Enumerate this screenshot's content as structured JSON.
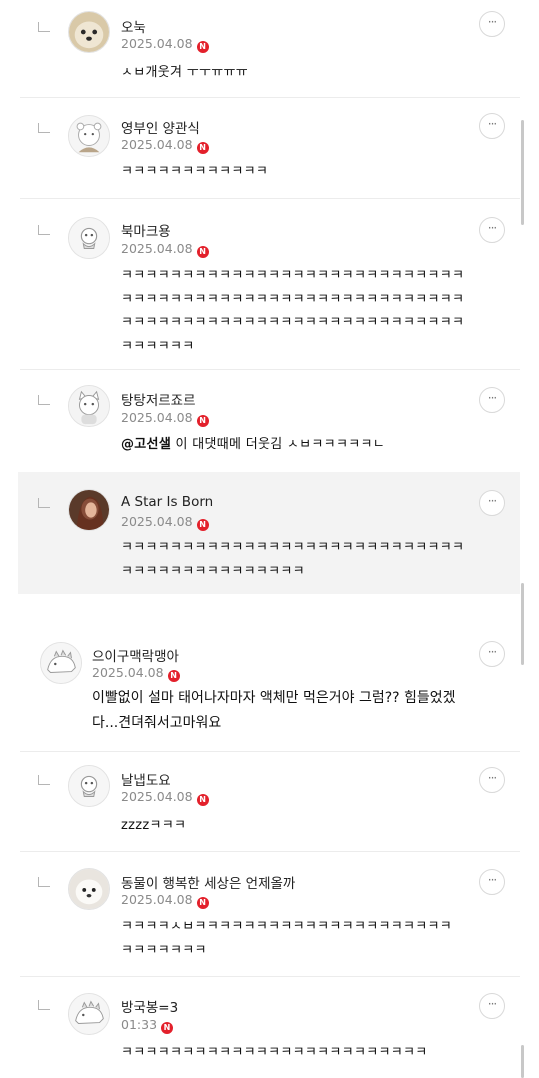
{
  "comments": [
    {
      "nickname": "오눅",
      "date": "2025.04.08",
      "badge": "N",
      "text": "ㅅㅂ개웃겨 ㅜㅜㅠㅠㅠ",
      "avatar": "dog-photo-avatar"
    },
    {
      "nickname": "영부인 양관식",
      "date": "2025.04.08",
      "badge": "N",
      "text": "ㅋㅋㅋㅋㅋㅋㅋㅋㅋㅋㅋㅋ",
      "avatar": "bear-character-avatar"
    },
    {
      "nickname": "북마크용",
      "date": "2025.04.08",
      "badge": "N",
      "text": "ㅋㅋㅋㅋㅋㅋㅋㅋㅋㅋㅋㅋㅋㅋㅋㅋㅋㅋㅋㅋㅋㅋㅋㅋㅋㅋㅋㅋ\nㅋㅋㅋㅋㅋㅋㅋㅋㅋㅋㅋㅋㅋㅋㅋㅋㅋㅋㅋㅋㅋㅋㅋㅋㅋㅋㅋㅋ\nㅋㅋㅋㅋㅋㅋㅋㅋㅋㅋㅋㅋㅋㅋㅋㅋㅋㅋㅋㅋㅋㅋㅋㅋㅋㅋㅋㅋ\nㅋㅋㅋㅋㅋㅋ",
      "avatar": "default-character-avatar"
    },
    {
      "nickname": "탕탕저르죠르",
      "date": "2025.04.08",
      "badge": "N",
      "mention": "@고선샐",
      "text": " 이 대댓때메 더웃김 ㅅㅂㅋㅋㅋㅋㅋㄴ",
      "avatar": "cat-character-avatar"
    },
    {
      "nickname": "A Star Is Born",
      "date": "2025.04.08",
      "badge": "N",
      "text": "ㅋㅋㅋㅋㅋㅋㅋㅋㅋㅋㅋㅋㅋㅋㅋㅋㅋㅋㅋㅋㅋㅋㅋㅋㅋㅋㅋㅋ\nㅋㅋㅋㅋㅋㅋㅋㅋㅋㅋㅋㅋㅋㅋㅋ",
      "avatar": "portrait-photo-avatar"
    },
    {
      "nickname": "으이구맥락맹아",
      "date": "2025.04.08",
      "badge": "N",
      "text": "이빨없이 설마 태어나자마자 액체만 먹은거야 그럼?? 힘들었겠\n다...견뎌줘서고마워요",
      "avatar": "dinosaur-character-avatar"
    },
    {
      "nickname": "날냅도요",
      "date": "2025.04.08",
      "badge": "N",
      "text": "zzzzㅋㅋㅋ",
      "avatar": "default-character-avatar"
    },
    {
      "nickname": "동물이 행복한 세상은 언제올까",
      "date": "2025.04.08",
      "badge": "N",
      "text": "ㅋㅋㅋㅋㅅㅂㅋㅋㅋㅋㅋㅋㅋㅋㅋㅋㅋㅋㅋㅋㅋㅋㅋㅋㅋㅋㅋ\nㅋㅋㅋㅋㅋㅋㅋ",
      "avatar": "puppy-photo-avatar"
    },
    {
      "nickname": "방국봉=3",
      "date": "01:33",
      "badge": "N",
      "text": "ㅋㅋㅋㅋㅋㅋㅋㅋㅋㅋㅋㅋㅋㅋㅋㅋㅋㅋㅋㅋㅋㅋㅋㅋㅋ",
      "avatar": "dinosaur-character-avatar"
    }
  ],
  "colors": {
    "badge": "#e3202b",
    "meta": "#8a8a8a",
    "separator": "#ececec"
  }
}
